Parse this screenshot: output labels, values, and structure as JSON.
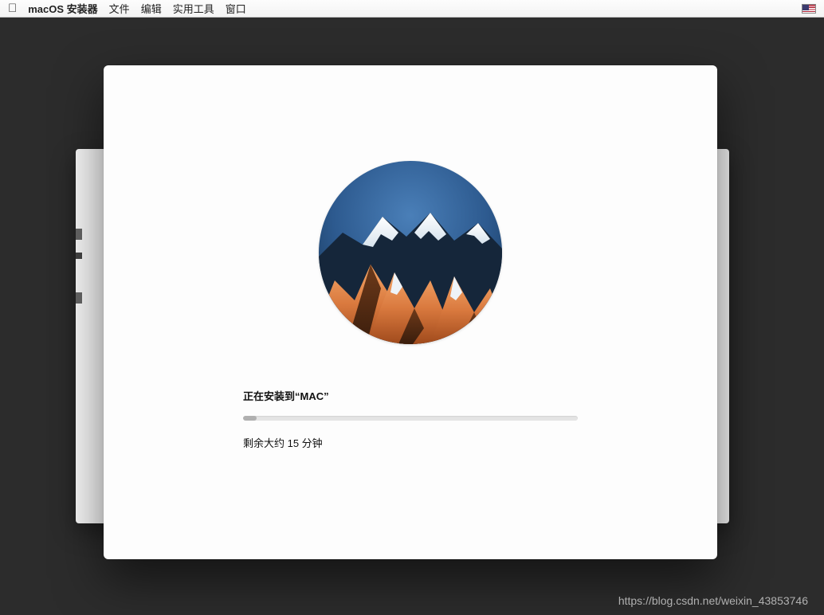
{
  "menubar": {
    "app_name": "macOS 安装器",
    "items": [
      "文件",
      "编辑",
      "实用工具",
      "窗口"
    ]
  },
  "installer": {
    "status_text": "正在安装到“MAC”",
    "time_remaining": "剩余大约 15 分钟",
    "progress_percent": 4
  },
  "watermark": "https://blog.csdn.net/weixin_43853746"
}
